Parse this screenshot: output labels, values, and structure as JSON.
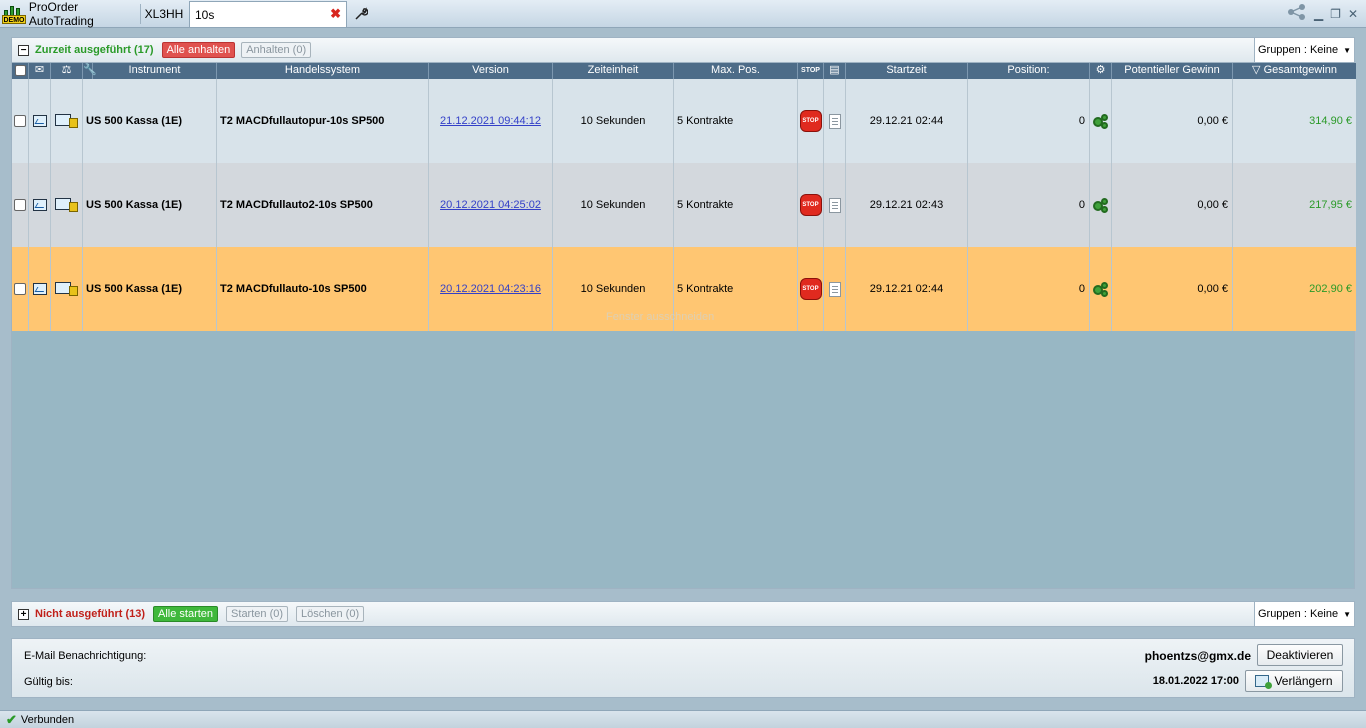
{
  "titlebar": {
    "app_title": "ProOrder AutoTrading",
    "demo_badge": "DEMO",
    "tabs": [
      {
        "label": "XL3HH"
      },
      {
        "label": "10s"
      }
    ],
    "close_glyph": "✖"
  },
  "running": {
    "toggle": "−",
    "title": "Zurzeit ausgeführt (17)",
    "btn_all_pause": "Alle anhalten",
    "btn_pause": "Anhalten (0)",
    "groups": "Gruppen : Keine",
    "title_color": "#2a9a28"
  },
  "table": {
    "headers": {
      "instrument": "Instrument",
      "system": "Handelssystem",
      "version": "Version",
      "timeframe": "Zeiteinheit",
      "maxpos": "Max. Pos.",
      "stop": "STOP",
      "start": "Startzeit",
      "position": "Position:",
      "potential": "Potentieller Gewinn",
      "total": "Gesamtgewinn"
    },
    "rows": [
      {
        "instrument": "US 500 Kassa (1E)",
        "system": "T2 MACDfullautopur-10s SP500",
        "version": "21.12.2021 09:44:12",
        "timeframe": "10 Sekunden",
        "maxpos": "5 Kontrakte",
        "stop": "STOP",
        "start": "29.12.21 02:44",
        "position": "0",
        "potential": "0,00 €",
        "total": "314,90 €",
        "bg": "#d8e3ea"
      },
      {
        "instrument": "US 500 Kassa (1E)",
        "system": "T2 MACDfullauto2-10s SP500",
        "version": "20.12.2021 04:25:02",
        "timeframe": "10 Sekunden",
        "maxpos": "5 Kontrakte",
        "stop": "STOP",
        "start": "29.12.21 02:43",
        "position": "0",
        "potential": "0,00 €",
        "total": "217,95 €",
        "bg": "#d3d8dd"
      },
      {
        "instrument": "US 500 Kassa (1E)",
        "system": "T2 MACDfullauto-10s SP500",
        "version": "20.12.2021 04:23:16",
        "timeframe": "10 Sekunden",
        "maxpos": "5 Kontrakte",
        "stop": "STOP",
        "start": "29.12.21 02:44",
        "position": "0",
        "potential": "0,00 €",
        "total": "202,90 €",
        "bg": "#ffc672"
      }
    ],
    "ghost_text": "Fenster ausschneiden"
  },
  "stopped": {
    "toggle": "+",
    "title": "Nicht ausgeführt (13)",
    "btn_all_start": "Alle starten",
    "btn_start": "Starten (0)",
    "btn_delete": "Löschen (0)",
    "groups": "Gruppen : Keine",
    "title_color": "#c0201a"
  },
  "email": {
    "label_notification": "E-Mail Benachrichtigung:",
    "label_valid": "Gültig bis:",
    "address": "phoentzs@gmx.de",
    "valid_until": "18.01.2022 17:00",
    "btn_deactivate": "Deaktivieren",
    "btn_extend": "Verlängern"
  },
  "status": {
    "text": "Verbunden"
  }
}
